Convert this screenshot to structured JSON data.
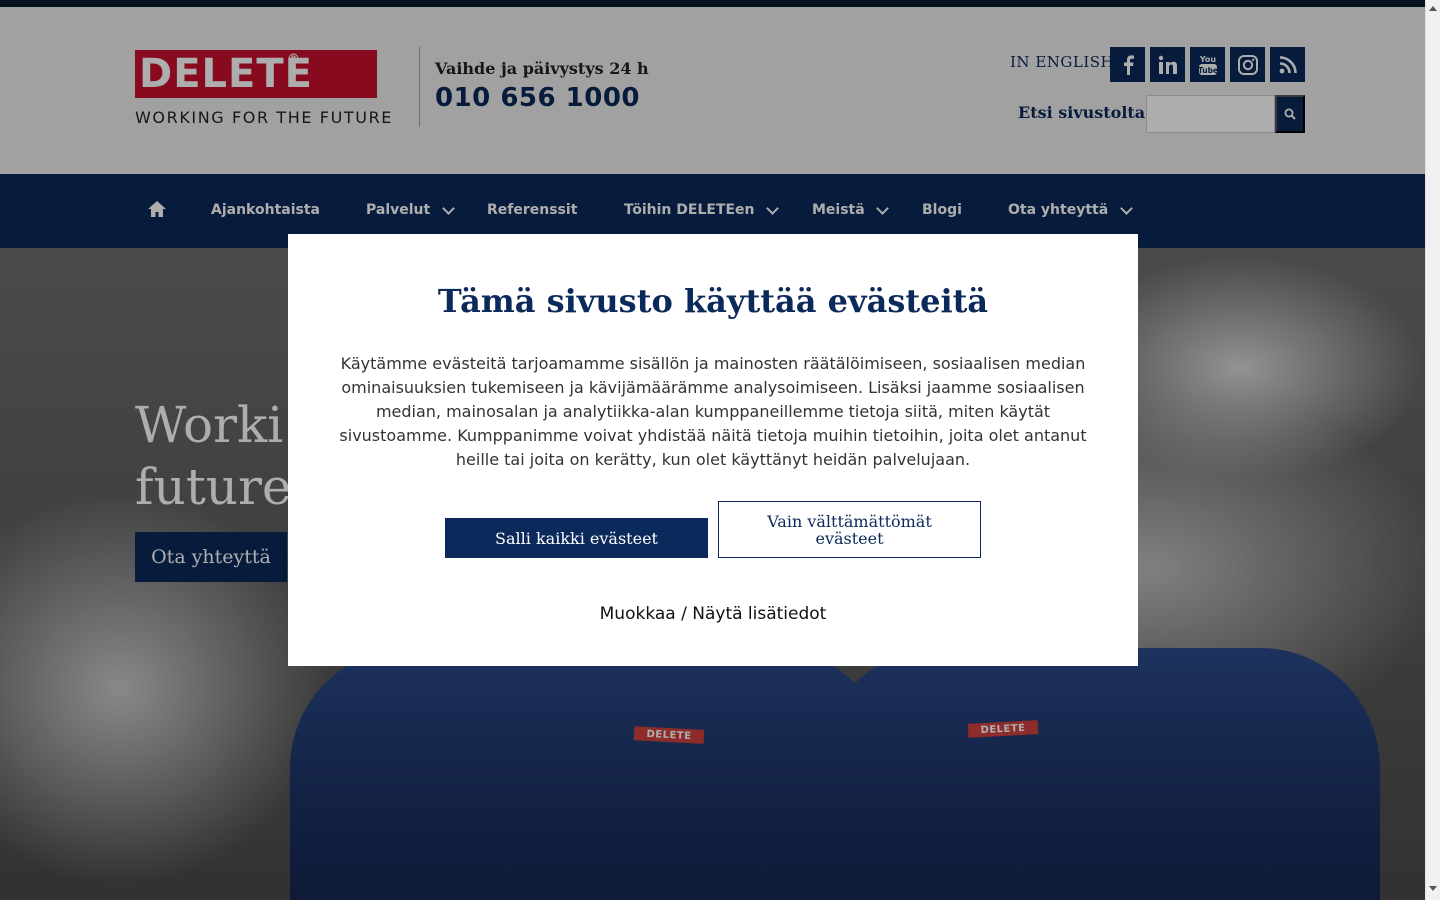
{
  "header": {
    "logo": {
      "word": "DELETE",
      "reg": "®",
      "tagline": "WORKING FOR THE FUTURE"
    },
    "phone_label": "Vaihde ja päivystys 24 h",
    "phone_number": "010 656 1000",
    "language_link": "IN ENGLISH",
    "social": [
      {
        "name": "facebook-icon",
        "glyph": "f"
      },
      {
        "name": "linkedin-icon",
        "glyph": "in"
      },
      {
        "name": "youtube-icon",
        "glyph": "You Tube"
      },
      {
        "name": "instagram-icon",
        "glyph": ""
      },
      {
        "name": "rss-icon",
        "glyph": ""
      }
    ],
    "search_label": "Etsi sivustolta:",
    "search_value": ""
  },
  "nav": {
    "items": [
      {
        "label": "Ajankohtaista",
        "has_submenu": false
      },
      {
        "label": "Palvelut",
        "has_submenu": true
      },
      {
        "label": "Referenssit",
        "has_submenu": false
      },
      {
        "label": "Töihin DELETEen",
        "has_submenu": true
      },
      {
        "label": "Meistä",
        "has_submenu": true
      },
      {
        "label": "Blogi",
        "has_submenu": false
      },
      {
        "label": "Ota yhteyttä",
        "has_submenu": true
      }
    ]
  },
  "hero": {
    "title": "Working for the\nfuture",
    "visible_title": "Worki\nfuture",
    "cta": "Ota yhteyttä",
    "badge": "DELETE"
  },
  "cookie_modal": {
    "title": "Tämä sivusto käyttää evästeitä",
    "text": "Käytämme evästeitä tarjoamamme sisällön ja mainosten räätälöimiseen, sosiaalisen median ominaisuuksien tukemiseen ja kävijämäärämme analysoimiseen. Lisäksi jaamme sosiaalisen median, mainosalan ja analytiikka-alan kumppaneillemme tietoja siitä, miten käytät sivustoamme. Kumppanimme voivat yhdistää näitä tietoja muihin tietoihin, joita olet antanut heille tai joita on kerätty, kun olet käyttänyt heidän palvelujaan.",
    "allow_all": "Salli kaikki evästeet",
    "necessary_only": "Vain välttämättömät evästeet",
    "customize": "Muokkaa / Näytä lisätiedot"
  },
  "colors": {
    "brand_navy": "#0b2a5b",
    "brand_red": "#c8102e"
  }
}
